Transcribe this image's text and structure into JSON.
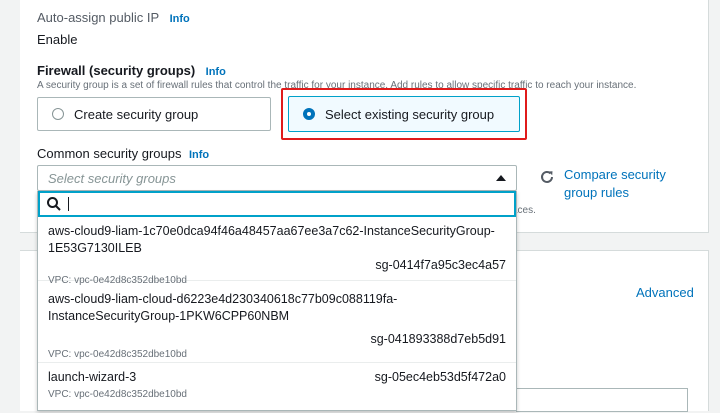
{
  "network": {
    "auto_assign_label": "Auto-assign public IP",
    "auto_assign_info": "Info",
    "auto_assign_value": "Enable"
  },
  "firewall": {
    "heading": "Firewall (security groups)",
    "info": "Info",
    "description": "A security group is a set of firewall rules that control the traffic for your instance. Add rules to allow specific traffic to reach your instance.",
    "options": [
      {
        "label": "Create security group",
        "selected": false
      },
      {
        "label": "Select existing security group",
        "selected": true
      }
    ]
  },
  "common_sg": {
    "label": "Common security groups",
    "info": "Info",
    "placeholder": "Select security groups",
    "compare_link_line1": "Compare security",
    "compare_link_line2": "group rules",
    "behind_text": "aces."
  },
  "dropdown": {
    "search_value": "",
    "items": [
      {
        "name_line1": "aws-cloud9-liam-1c70e0dca94f46a48457aa67ee3a7c62-InstanceSecurityGroup-",
        "name_line2": "1E53G7130ILEB",
        "id": "sg-0414f7a95c3ec4a57",
        "vpc": "VPC: vpc-0e42d8c352dbe10bd"
      },
      {
        "name_line1": "aws-cloud9-liam-cloud-d6223e4d230340618c77b09c088119fa-",
        "name_line2": "InstanceSecurityGroup-1PKW6CPP60NBM",
        "id": "sg-041893388d7eb5d91",
        "vpc": "VPC: vpc-0e42d8c352dbe10bd"
      },
      {
        "name_line1": "launch-wizard-3",
        "name_line2": "",
        "id": "sg-05ec4eb53d5f472a0",
        "vpc": "VPC: vpc-0e42d8c352dbe10bd"
      }
    ]
  },
  "storage": {
    "advanced_link": "Advanced"
  }
}
